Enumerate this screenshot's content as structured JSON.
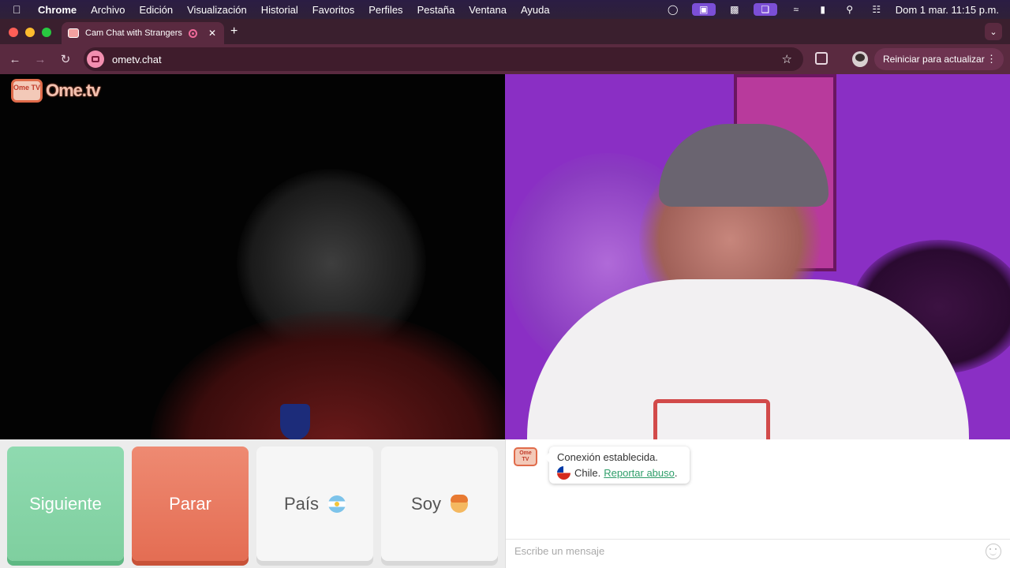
{
  "menubar": {
    "items": [
      "Chrome",
      "Archivo",
      "Edición",
      "Visualización",
      "Historial",
      "Favoritos",
      "Perfiles",
      "Pestaña",
      "Ventana",
      "Ayuda"
    ],
    "clock": "Dom 1 mar.  11:15 p.m."
  },
  "browser": {
    "tab_title": "Cam Chat with Strangers",
    "new_tab": "+",
    "url": "ometv.chat",
    "update_label": "Reiniciar para actualizar"
  },
  "site": {
    "logo_tv": "Ome TV",
    "logo_text": "Ome.tv"
  },
  "controls": {
    "next_label": "Siguiente",
    "stop_label": "Parar",
    "country_label": "País",
    "country_flag": "argentina-flag-icon",
    "gender_label": "Soy",
    "gender_icon": "boy-face-icon"
  },
  "chat": {
    "status": "Conexión establecida.",
    "country": "Chile.",
    "report_link": "Reportar abuso",
    "report_suffix": ".",
    "input_placeholder": "Escribe un mensaje"
  },
  "colors": {
    "next": "#8fdab0",
    "stop": "#ee8a72",
    "link": "#2f9e6a",
    "brand": "#e06b4a"
  }
}
